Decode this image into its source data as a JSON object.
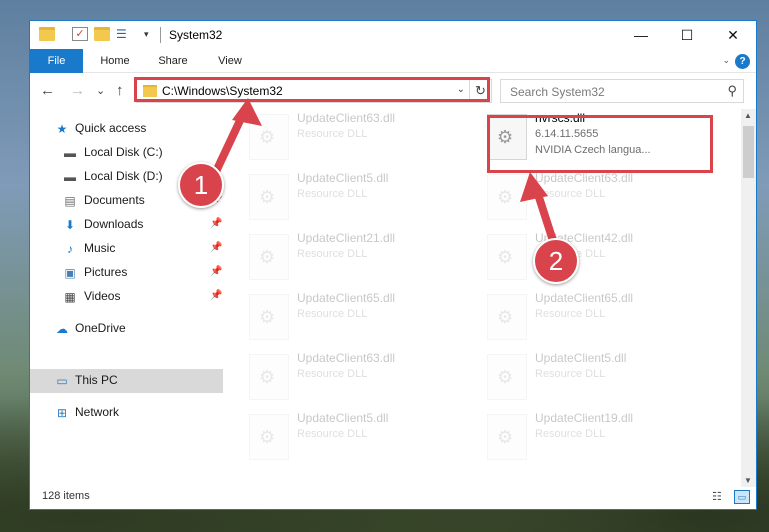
{
  "window": {
    "title": "System32",
    "controls": {
      "minimize": "—",
      "maximize": "☐",
      "close": "✕"
    }
  },
  "ribbon": {
    "tabs": [
      "File",
      "Home",
      "Share",
      "View"
    ],
    "help_icon": "?"
  },
  "navigation": {
    "back": "←",
    "forward": "→",
    "recent": "⌄",
    "up": "↑"
  },
  "address": {
    "path": "C:\\Windows\\System32",
    "dropdown": "⌄",
    "refresh": "↻"
  },
  "search": {
    "placeholder": "Search System32",
    "icon": "⚲"
  },
  "sidebar": {
    "items": [
      {
        "label": "Quick access",
        "icon": "star-icon",
        "glyph": "★",
        "color": "#1979ca"
      },
      {
        "label": "Local Disk (C:)",
        "icon": "drive-icon",
        "glyph": "▬",
        "color": "#555555"
      },
      {
        "label": "Local Disk (D:)",
        "icon": "drive-icon",
        "glyph": "▬",
        "color": "#555555"
      },
      {
        "label": "Documents",
        "icon": "documents-icon",
        "glyph": "▤",
        "color": "#6b6b6b",
        "pinned": true
      },
      {
        "label": "Downloads",
        "icon": "download-icon",
        "glyph": "⬇",
        "color": "#1979ca",
        "pinned": true
      },
      {
        "label": "Music",
        "icon": "music-icon",
        "glyph": "♪",
        "color": "#1979ca",
        "pinned": true
      },
      {
        "label": "Pictures",
        "icon": "pictures-icon",
        "glyph": "▣",
        "color": "#4a7fb5",
        "pinned": true
      },
      {
        "label": "Videos",
        "icon": "videos-icon",
        "glyph": "▦",
        "color": "#444444",
        "pinned": true
      },
      {
        "label": "OneDrive",
        "icon": "cloud-icon",
        "glyph": "☁",
        "color": "#1979ca"
      },
      {
        "label": "This PC",
        "icon": "computer-icon",
        "glyph": "▭",
        "color": "#2d7cc3",
        "selected": true
      },
      {
        "label": "Network",
        "icon": "network-icon",
        "glyph": "⊞",
        "color": "#2d7cc3"
      }
    ],
    "pin_glyph": "📌"
  },
  "files": {
    "left_column": [
      {
        "name": "UpdateClient63.dll",
        "type": "Resource DLL"
      },
      {
        "name": "UpdateClient5.dll",
        "type": "Resource DLL"
      },
      {
        "name": "UpdateClient21.dll",
        "type": "Resource DLL"
      },
      {
        "name": "UpdateClient65.dll",
        "type": "Resource DLL"
      },
      {
        "name": "UpdateClient63.dll",
        "type": "Resource DLL"
      },
      {
        "name": "UpdateClient5.dll",
        "type": "Resource DLL"
      }
    ],
    "right_column": [
      {
        "name": "nvrscs.dll",
        "version": "6.14.11.5655",
        "type": "NVIDIA Czech langua...",
        "highlighted": true
      },
      {
        "name": "UpdateClient63.dll",
        "type": "Resource DLL"
      },
      {
        "name": "UpdateClient42.dll",
        "type": "Resource DLL"
      },
      {
        "name": "UpdateClient65.dll",
        "type": "Resource DLL"
      },
      {
        "name": "UpdateClient5.dll",
        "type": "Resource DLL"
      },
      {
        "name": "UpdateClient19.dll",
        "type": "Resource DLL"
      }
    ]
  },
  "status": {
    "item_count": "128 items"
  },
  "annotations": {
    "step1": "1",
    "step2": "2",
    "accent": "#d9434b"
  }
}
